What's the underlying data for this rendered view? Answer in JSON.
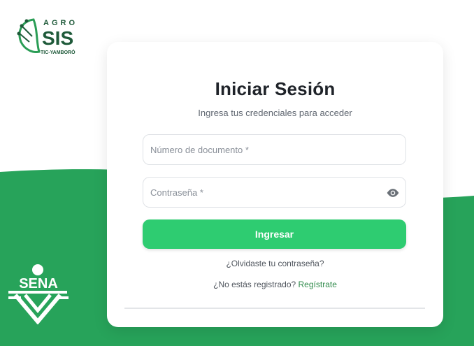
{
  "brand": {
    "top_word": "AGRO",
    "main_word": "SIS",
    "tagline": "TIC-YAMBORÓ",
    "primary_color": "#1f5a3a",
    "leaf_color": "#2a9d55"
  },
  "sena": {
    "name": "SENA",
    "color": "#ffffff"
  },
  "theme": {
    "background_green": "#27a35a",
    "button_green": "#2ecc71",
    "link_green": "#2f8a4a"
  },
  "login": {
    "title": "Iniciar Sesión",
    "subtitle": "Ingresa tus credenciales para acceder",
    "document_placeholder": "Número de documento *",
    "document_value": "",
    "password_placeholder": "Contraseña *",
    "password_value": "",
    "show_password_icon": "eye-icon",
    "submit_label": "Ingresar",
    "forgot_label": "¿Olvidaste tu contraseña?",
    "register_prompt": "¿No estás registrado?",
    "register_link": "Regístrate"
  }
}
